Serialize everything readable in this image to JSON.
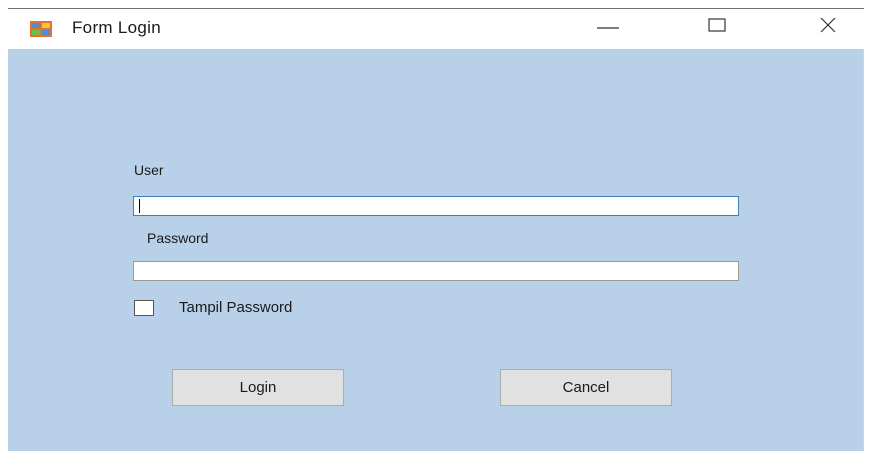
{
  "window": {
    "title": "Form Login",
    "icon": "app-form-icon",
    "controls": {
      "minimize_icon": "minimize-icon",
      "maximize_icon": "maximize-icon",
      "close_icon": "close-icon"
    },
    "background_color": "#b9d0e9"
  },
  "form": {
    "user_label": "User",
    "user_value": "",
    "password_label": "Password",
    "password_value": "",
    "show_password_label": "Tampil Password",
    "show_password_checked": false,
    "login_label": "Login",
    "cancel_label": "Cancel"
  }
}
